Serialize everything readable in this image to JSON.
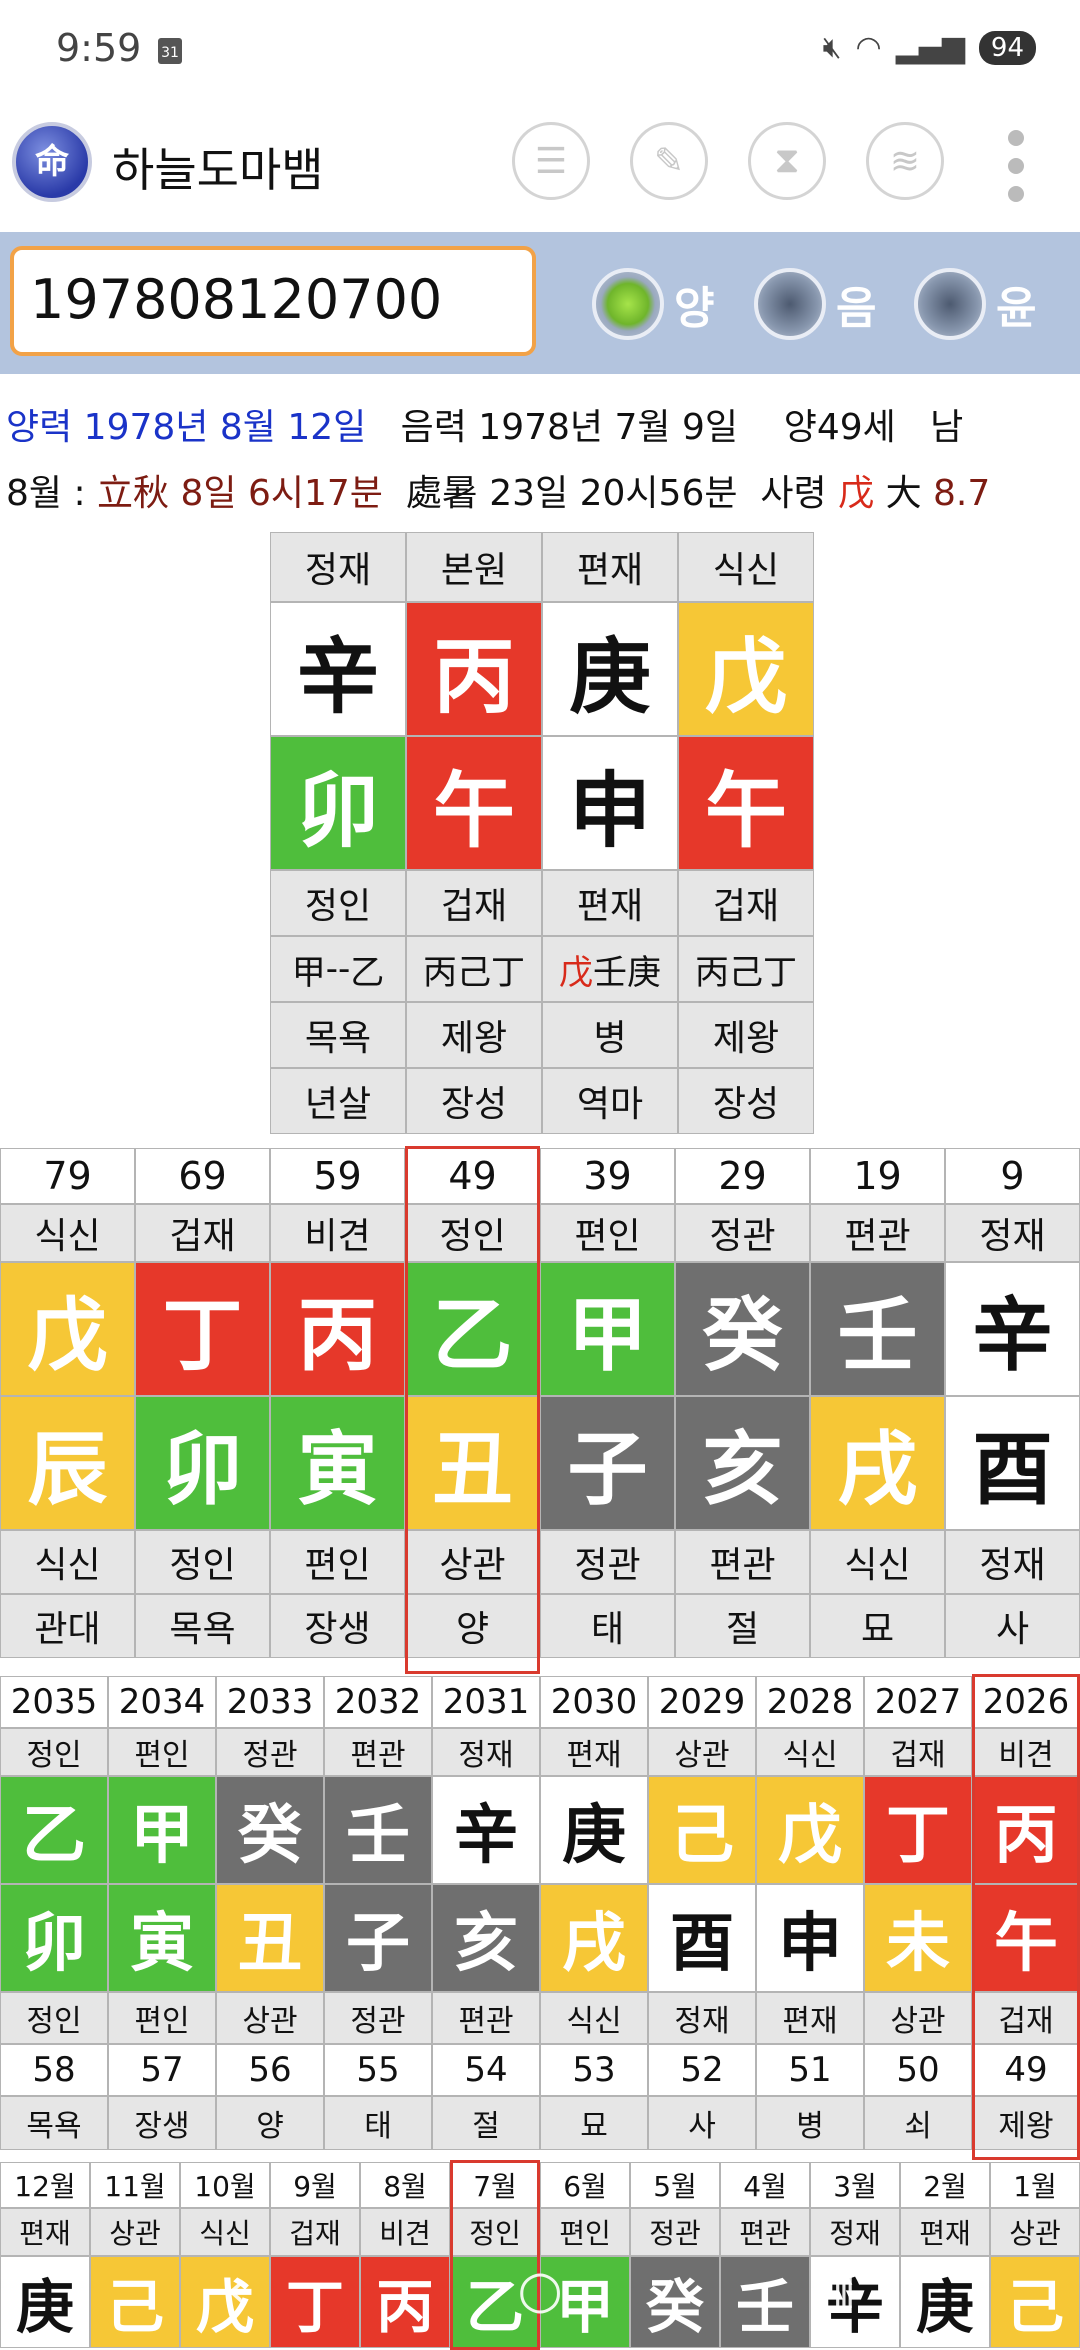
{
  "status_bar": {
    "time": "9:59",
    "calendar_day": "31",
    "battery": "94",
    "icons": [
      "mute-icon",
      "wifi-icon",
      "signal-icon"
    ]
  },
  "app": {
    "logo_text": "命",
    "title": "하늘도마뱀",
    "toolbar_icons": [
      "list-icon",
      "edit-icon",
      "hourglass-icon",
      "database-icon",
      "more-icon"
    ]
  },
  "input": {
    "value": "197808120700"
  },
  "calendar_options": [
    {
      "label": "양",
      "selected": true
    },
    {
      "label": "음",
      "selected": false
    },
    {
      "label": "윤",
      "selected": false
    }
  ],
  "info": {
    "solar": "양력 1978년 8월 12일",
    "lunar": "음력 1978년 7월 9일",
    "age": "양49세",
    "sex": "남",
    "month_prefix": "8월 : ",
    "term1": "立秋 8일 6시17분",
    "term2": "處暑 23일 20시56분",
    "saryeong_label": "사령",
    "saryeong_char": "戊",
    "daeun_label": "大",
    "daeun_value": "8.7"
  },
  "pillars": {
    "top": [
      "정재",
      "본원",
      "편재",
      "식신"
    ],
    "stems": [
      {
        "ch": "辛",
        "color": "W"
      },
      {
        "ch": "丙",
        "color": "R"
      },
      {
        "ch": "庚",
        "color": "W"
      },
      {
        "ch": "戊",
        "color": "Y"
      }
    ],
    "branches": [
      {
        "ch": "卯",
        "color": "G"
      },
      {
        "ch": "午",
        "color": "R"
      },
      {
        "ch": "申",
        "color": "W"
      },
      {
        "ch": "午",
        "color": "R"
      }
    ],
    "ten_gods": [
      "정인",
      "겁재",
      "편재",
      "겁재"
    ],
    "hidden_stems": [
      [
        "甲",
        "--",
        "乙"
      ],
      [
        "丙",
        "己",
        "丁"
      ],
      [
        "戊",
        "壬",
        "庚"
      ],
      [
        "丙",
        "己",
        "丁"
      ]
    ],
    "twelve_stages": [
      "목욕",
      "제왕",
      "병",
      "제왕"
    ],
    "twelve_spirits": [
      "년살",
      "장성",
      "역마",
      "장성"
    ]
  },
  "daeun": {
    "ages": [
      "79",
      "69",
      "59",
      "49",
      "39",
      "29",
      "19",
      "9"
    ],
    "top": [
      "식신",
      "겁재",
      "비견",
      "정인",
      "편인",
      "정관",
      "편관",
      "정재"
    ],
    "stems": [
      {
        "ch": "戊",
        "color": "Y"
      },
      {
        "ch": "丁",
        "color": "R"
      },
      {
        "ch": "丙",
        "color": "R"
      },
      {
        "ch": "乙",
        "color": "G"
      },
      {
        "ch": "甲",
        "color": "G"
      },
      {
        "ch": "癸",
        "color": "D"
      },
      {
        "ch": "壬",
        "color": "D"
      },
      {
        "ch": "辛",
        "color": "W"
      }
    ],
    "branches": [
      {
        "ch": "辰",
        "color": "Y"
      },
      {
        "ch": "卯",
        "color": "G"
      },
      {
        "ch": "寅",
        "color": "G"
      },
      {
        "ch": "丑",
        "color": "Y"
      },
      {
        "ch": "子",
        "color": "D"
      },
      {
        "ch": "亥",
        "color": "D"
      },
      {
        "ch": "戌",
        "color": "Y"
      },
      {
        "ch": "酉",
        "color": "W"
      }
    ],
    "bottom": [
      "식신",
      "정인",
      "편인",
      "상관",
      "정관",
      "편관",
      "식신",
      "정재"
    ],
    "stages": [
      "관대",
      "목욕",
      "장생",
      "양",
      "태",
      "절",
      "묘",
      "사"
    ]
  },
  "yearly": {
    "years": [
      "2035",
      "2034",
      "2033",
      "2032",
      "2031",
      "2030",
      "2029",
      "2028",
      "2027",
      "2026"
    ],
    "top": [
      "정인",
      "편인",
      "정관",
      "편관",
      "정재",
      "편재",
      "상관",
      "식신",
      "겁재",
      "비견"
    ],
    "stems": [
      {
        "ch": "乙",
        "color": "G"
      },
      {
        "ch": "甲",
        "color": "G"
      },
      {
        "ch": "癸",
        "color": "D"
      },
      {
        "ch": "壬",
        "color": "D"
      },
      {
        "ch": "辛",
        "color": "W"
      },
      {
        "ch": "庚",
        "color": "W"
      },
      {
        "ch": "己",
        "color": "Y"
      },
      {
        "ch": "戊",
        "color": "Y"
      },
      {
        "ch": "丁",
        "color": "R"
      },
      {
        "ch": "丙",
        "color": "R"
      }
    ],
    "branches": [
      {
        "ch": "卯",
        "color": "G"
      },
      {
        "ch": "寅",
        "color": "G"
      },
      {
        "ch": "丑",
        "color": "Y"
      },
      {
        "ch": "子",
        "color": "D"
      },
      {
        "ch": "亥",
        "color": "D"
      },
      {
        "ch": "戌",
        "color": "Y"
      },
      {
        "ch": "酉",
        "color": "W"
      },
      {
        "ch": "申",
        "color": "W"
      },
      {
        "ch": "未",
        "color": "Y"
      },
      {
        "ch": "午",
        "color": "R"
      }
    ],
    "bottom": [
      "정인",
      "편인",
      "상관",
      "정관",
      "편관",
      "식신",
      "정재",
      "편재",
      "상관",
      "겁재"
    ],
    "ages": [
      "58",
      "57",
      "56",
      "55",
      "54",
      "53",
      "52",
      "51",
      "50",
      "49"
    ],
    "stages": [
      "목욕",
      "장생",
      "양",
      "태",
      "절",
      "묘",
      "사",
      "병",
      "쇠",
      "제왕"
    ]
  },
  "monthly": {
    "months": [
      "12월",
      "11월",
      "10월",
      "9월",
      "8월",
      "7월",
      "6월",
      "5월",
      "4월",
      "3월",
      "2월",
      "1월"
    ],
    "top": [
      "편재",
      "상관",
      "식신",
      "겁재",
      "비견",
      "정인",
      "편인",
      "정관",
      "편관",
      "정재",
      "편재",
      "상관"
    ],
    "stems": [
      {
        "ch": "庚",
        "color": "W"
      },
      {
        "ch": "己",
        "color": "Y"
      },
      {
        "ch": "戊",
        "color": "Y"
      },
      {
        "ch": "丁",
        "color": "R"
      },
      {
        "ch": "丙",
        "color": "R"
      },
      {
        "ch": "乙",
        "color": "G"
      },
      {
        "ch": "甲",
        "color": "G"
      },
      {
        "ch": "癸",
        "color": "D"
      },
      {
        "ch": "壬",
        "color": "D"
      },
      {
        "ch": "辛",
        "color": "W"
      },
      {
        "ch": "庚",
        "color": "W"
      },
      {
        "ch": "己",
        "color": "Y"
      }
    ]
  },
  "colors": {
    "R": "#e6382a",
    "G": "#4fbe3c",
    "Y": "#f6c736",
    "D": "#6f6f6f",
    "W": "#ffffff",
    "highlight": "#d93a2e"
  },
  "nav": [
    "back-icon",
    "home-icon",
    "recents-icon"
  ]
}
